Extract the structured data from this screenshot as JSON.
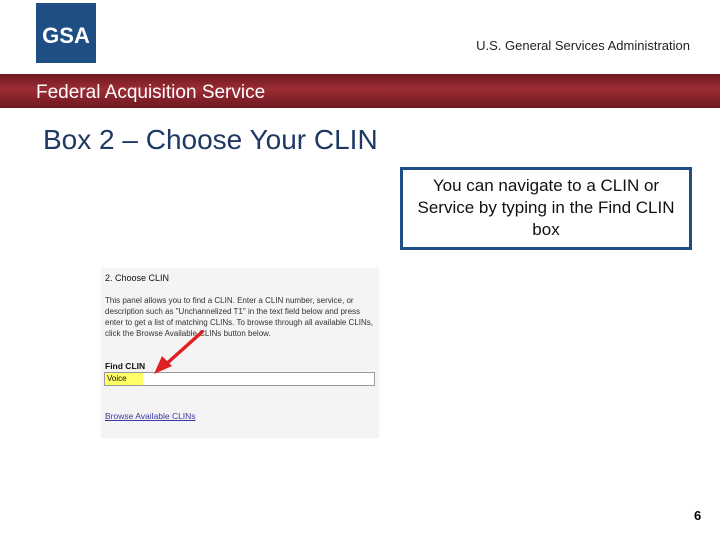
{
  "header": {
    "logo_text": "GSA",
    "agency": "U.S. General Services Administration"
  },
  "banner": {
    "title": "Federal Acquisition Service"
  },
  "slide": {
    "title": "Box 2 – Choose Your CLIN",
    "callout": "You can navigate to a CLIN or Service by typing in the Find CLIN box",
    "page_number": "6"
  },
  "screenshot": {
    "heading": "2. Choose CLIN",
    "description": "This panel allows you to find a CLIN. Enter a CLIN number, service, or description such as \"Unchannelized T1\" in the text field below and press enter to get a list of matching CLINs. To browse through all available CLINs, click the Browse Available CLINs button below.",
    "find_label": "Find CLIN",
    "find_value": "Voice",
    "browse_link": "Browse Available CLINs"
  },
  "colors": {
    "banner": "#8b232b",
    "title_blue": "#1f3864",
    "callout_border": "#1f4e85",
    "arrow": "#e02020",
    "highlight": "#ffff66"
  }
}
